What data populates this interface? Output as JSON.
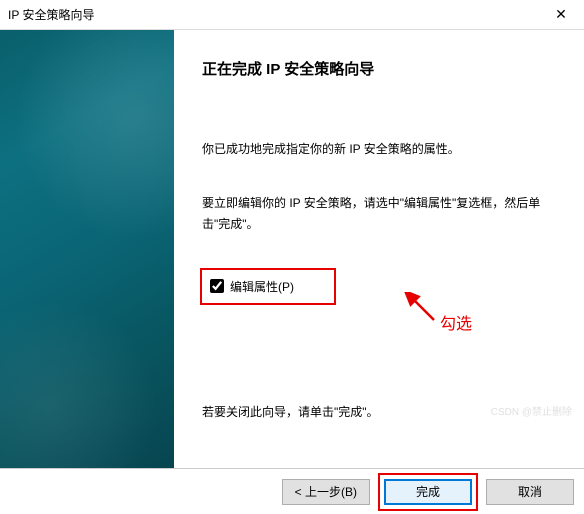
{
  "window": {
    "title": "IP 安全策略向导"
  },
  "main": {
    "heading": "正在完成 IP 安全策略向导",
    "success_text": "你已成功地完成指定你的新 IP 安全策略的属性。",
    "instruction_text": "要立即编辑你的 IP 安全策略，请选中\"编辑属性\"复选框，然后单击\"完成\"。",
    "checkbox_label": "编辑属性(P)",
    "close_hint": "若要关闭此向导，请单击\"完成\"。"
  },
  "annotation": {
    "label": "勾选"
  },
  "footer": {
    "back": "< 上一步(B)",
    "finish": "完成",
    "cancel": "取消"
  },
  "watermark": "CSDN @禁止删除"
}
